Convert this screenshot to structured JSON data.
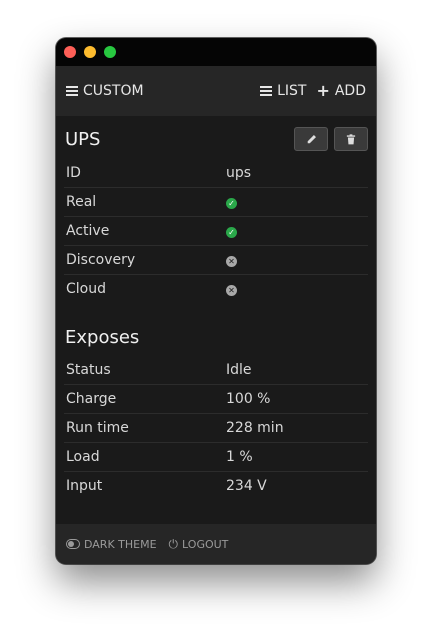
{
  "navbar": {
    "custom_label": "CUSTOM",
    "list_label": "LIST",
    "add_label": "ADD"
  },
  "device": {
    "title": "UPS",
    "edit_icon": "pencil-icon",
    "delete_icon": "trash-icon",
    "rows": [
      {
        "key": "ID",
        "value": "ups"
      },
      {
        "key": "Real",
        "status": "check"
      },
      {
        "key": "Active",
        "status": "check"
      },
      {
        "key": "Discovery",
        "status": "x"
      },
      {
        "key": "Cloud",
        "status": "x"
      }
    ]
  },
  "exposes": {
    "title": "Exposes",
    "rows": [
      {
        "key": "Status",
        "value": "Idle"
      },
      {
        "key": "Charge",
        "value": "100 %"
      },
      {
        "key": "Run time",
        "value": "228 min"
      },
      {
        "key": "Load",
        "value": "1 %"
      },
      {
        "key": "Input",
        "value": "234 V"
      }
    ]
  },
  "footer": {
    "dark_theme_label": "DARK THEME",
    "logout_label": "LOGOUT"
  },
  "colors": {
    "ok": "#2aa84a",
    "off": "#a8a8a8",
    "background": "#1a1a1a"
  }
}
